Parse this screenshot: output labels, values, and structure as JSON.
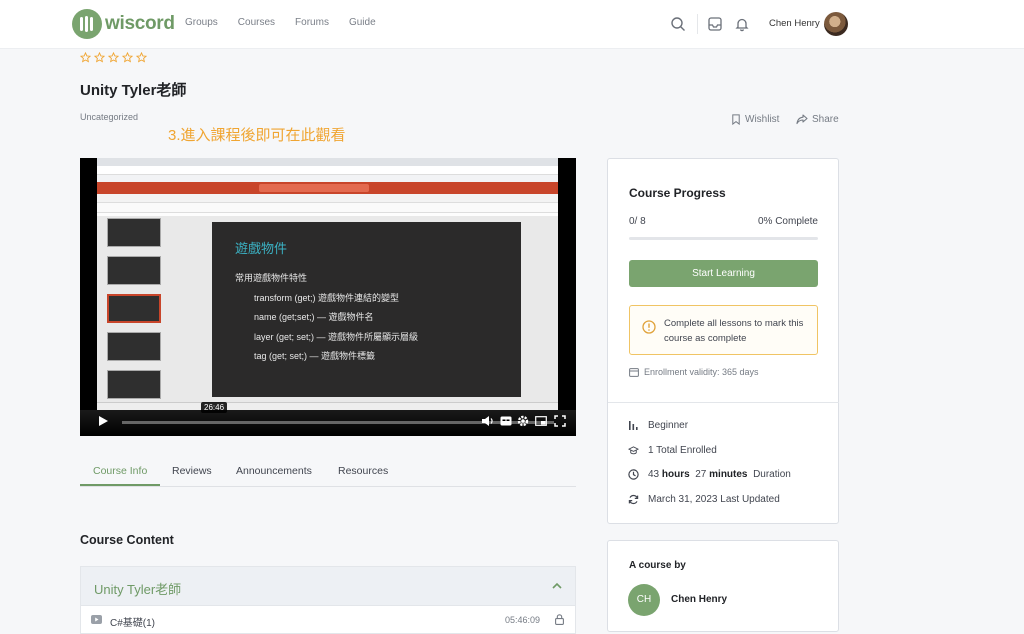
{
  "header": {
    "logo_text": "wiscord",
    "nav": [
      "Groups",
      "Courses",
      "Forums",
      "Guide"
    ],
    "user_name": "Chen Henry"
  },
  "course": {
    "rating_stars": 0,
    "title": "Unity Tyler老師",
    "category": "Uncategorized",
    "overlay_note": "3.進入課程後即可在此觀看",
    "wishlist_label": "Wishlist",
    "share_label": "Share"
  },
  "video": {
    "current_time": "26:46",
    "slide_title": "遊戲物件",
    "slide_lines": [
      "常用遊戲物件特性",
      "transform (get;) 遊戲物件連結的變型",
      "name (get;set;) — 遊戲物件名",
      "layer (get; set;) — 遊戲物件所屬顯示層級",
      "tag (get; set;) — 遊戲物件標籤"
    ]
  },
  "tabs": [
    "Course Info",
    "Reviews",
    "Announcements",
    "Resources"
  ],
  "active_tab": "Course Info",
  "content": {
    "heading": "Course Content",
    "topic_title": "Unity Tyler老師",
    "lessons": [
      {
        "title": "C#基礎(1)",
        "duration": "05:46:09"
      }
    ]
  },
  "progress": {
    "title": "Course Progress",
    "count": "0/ 8",
    "percent_text": "0% Complete",
    "percent_value": 0,
    "start_button": "Start Learning",
    "notice": "Complete all lessons to mark this course as complete",
    "validity": "Enrollment validity: 365 days"
  },
  "meta": {
    "level": "Beginner",
    "enrolled": "1 Total Enrolled",
    "duration_hours": "43",
    "duration_hours_label": "hours",
    "duration_minutes": "27",
    "duration_minutes_label": "minutes",
    "duration_label": "Duration",
    "updated": "March 31, 2023 Last Updated"
  },
  "instructor": {
    "label": "A course by",
    "initials": "CH",
    "name": "Chen Henry"
  },
  "colors": {
    "brand": "#6f9a66",
    "button": "#7aa46f",
    "note": "#f0a532",
    "notice_border": "#f0c464"
  }
}
